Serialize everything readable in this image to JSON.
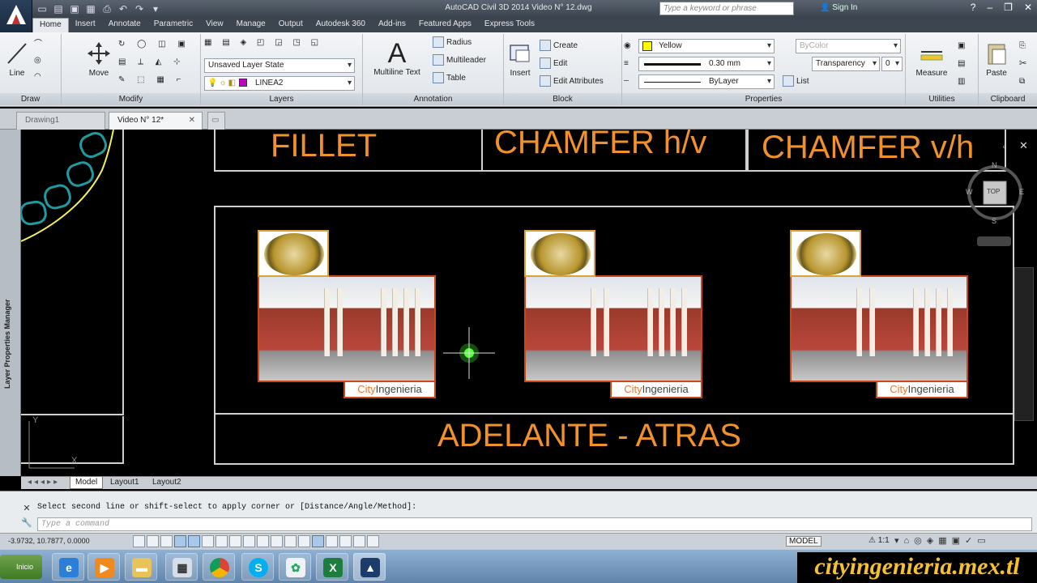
{
  "app": {
    "window_title": "AutoCAD Civil 3D 2014    Video N° 12.dwg",
    "search_placeholder": "Type a keyword or phrase",
    "sign_in": "Sign In"
  },
  "ribbon_tabs": [
    "Home",
    "Insert",
    "Annotate",
    "Parametric",
    "View",
    "Manage",
    "Output",
    "Autodesk 360",
    "Add-ins",
    "Featured Apps",
    "Express Tools"
  ],
  "ribbon": {
    "draw": {
      "title": "Draw",
      "line": "Line"
    },
    "modify": {
      "title": "Modify",
      "move": "Move"
    },
    "layers": {
      "title": "Layers",
      "layer_state": "Unsaved Layer State",
      "current_layer": "LINEA2"
    },
    "annotation": {
      "title": "Annotation",
      "mtext": "Multiline Text",
      "radius": "Radius",
      "multileader": "Multileader",
      "table": "Table"
    },
    "block": {
      "title": "Block",
      "insert": "Insert",
      "create": "Create",
      "edit": "Edit",
      "edit_attributes": "Edit Attributes"
    },
    "properties": {
      "title": "Properties",
      "color": "Yellow",
      "lineweight": "0.30 mm",
      "linetype": "ByLayer",
      "bycolor": "ByColor",
      "transparency": "Transparency",
      "transparency_value": "0",
      "list": "List"
    },
    "utilities": {
      "title": "Utilities",
      "measure": "Measure"
    },
    "clipboard": {
      "title": "Clipboard",
      "paste": "Paste"
    }
  },
  "doc_tabs": [
    {
      "label": "Drawing1"
    },
    {
      "label": "Video N° 12*"
    }
  ],
  "side_palette": "Layer Properties Manager",
  "drawing": {
    "headers": [
      "FILLET",
      "CHAMFER h/v",
      "CHAMFER v/h"
    ],
    "footer": "ADELANTE - ATRAS",
    "badge_prefix": "City",
    "badge_suffix": "Ingenieria",
    "accent": "#f0912c"
  },
  "viewcube": {
    "top": "TOP",
    "n": "N",
    "s": "S",
    "e": "E",
    "w": "W"
  },
  "layout_tabs": [
    "Model",
    "Layout1",
    "Layout2"
  ],
  "command": {
    "history": "Select second line or shift-select to apply corner or [Distance/Angle/Method]:",
    "placeholder": "Type a command"
  },
  "status": {
    "coords": "-3.9732, 10.7877, 0.0000",
    "model": "MODEL",
    "scale": "1:1"
  },
  "taskbar": {
    "start": "Inicio",
    "watermark": "cityingenieria.mex.tl"
  }
}
